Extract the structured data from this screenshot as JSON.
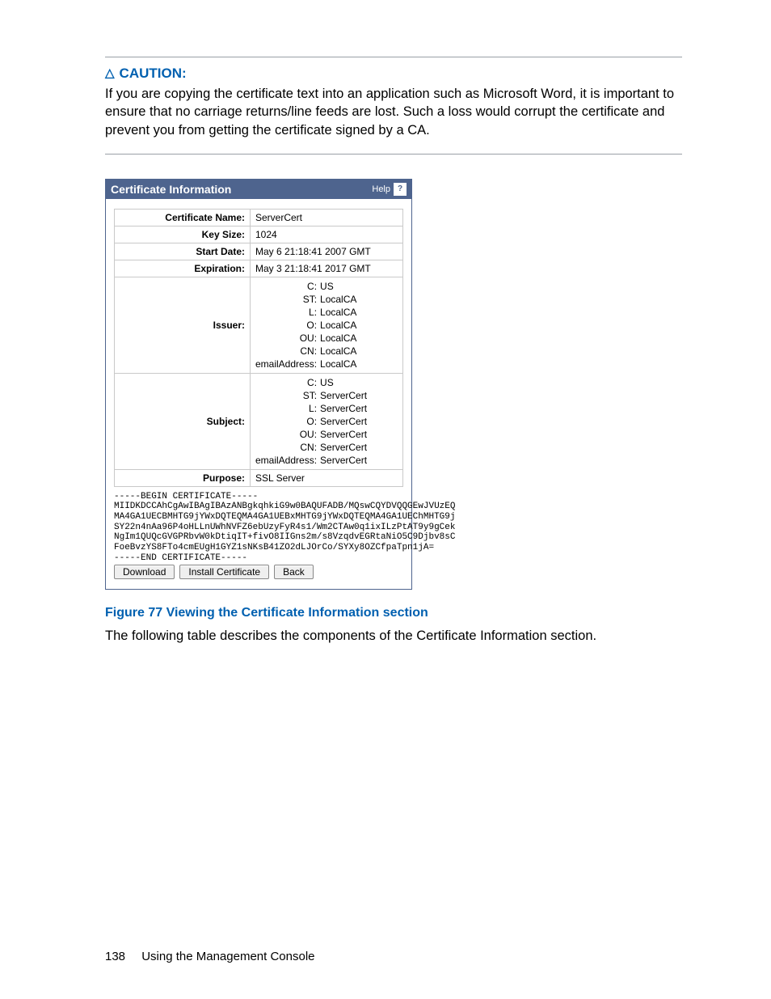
{
  "caution": {
    "label": "CAUTION:",
    "text": "If you are copying the certificate text into an application such as Microsoft Word, it is important to ensure that no carriage returns/line feeds are lost. Such a loss would corrupt the certificate and prevent you from getting the certificate signed by a CA."
  },
  "panel": {
    "title": "Certificate Information",
    "help_label": "Help",
    "rows": {
      "cert_name_label": "Certificate Name:",
      "cert_name_value": "ServerCert",
      "key_size_label": "Key Size:",
      "key_size_value": "1024",
      "start_date_label": "Start Date:",
      "start_date_value": "May  6 21:18:41 2007 GMT",
      "expiration_label": "Expiration:",
      "expiration_value": "May  3 21:18:41 2017 GMT",
      "issuer_label": "Issuer:",
      "subject_label": "Subject:",
      "purpose_label": "Purpose:",
      "purpose_value": "SSL Server"
    },
    "dn_keys": {
      "c": "C:",
      "st": "ST:",
      "l": "L:",
      "o": "O:",
      "ou": "OU:",
      "cn": "CN:",
      "email": "emailAddress:"
    },
    "issuer": {
      "c": "US",
      "st": "LocalCA",
      "l": "LocalCA",
      "o": "LocalCA",
      "ou": "LocalCA",
      "cn": "LocalCA",
      "email": "LocalCA"
    },
    "subject": {
      "c": "US",
      "st": "ServerCert",
      "l": "ServerCert",
      "o": "ServerCert",
      "ou": "ServerCert",
      "cn": "ServerCert",
      "email": "ServerCert"
    },
    "pem": "-----BEGIN CERTIFICATE-----\nMIIDKDCCAhCgAwIBAgIBAzANBgkqhkiG9w0BAQUFADB/MQswCQYDVQQGEwJVUzEQ\nMA4GA1UECBMHTG9jYWxDQTEQMA4GA1UEBxMHTG9jYWxDQTEQMA4GA1UEChMHTG9j\nSY22n4nAa96P4oHLLnUWhNVFZ6ebUzyFyR4s1/Wm2CTAw0q1ixILzPtAT9y9gCek\nNgIm1QUQcGVGPRbvW0kDtiqIT+fivO8IIGns2m/s8VzqdvEGRtaNiO5C9Djbv8sC\nFoeBvzYS8FTo4cmEUgH1GYZ1sNKsB41ZO2dLJOrCo/SYXy8OZCfpaTpn1jA=\n-----END CERTIFICATE-----",
    "buttons": {
      "download": "Download",
      "install": "Install Certificate",
      "back": "Back"
    }
  },
  "figure_caption": "Figure 77 Viewing the Certificate Information section",
  "following_text": "The following table describes the components of the Certificate Information section.",
  "footer": {
    "page": "138",
    "section": "Using the Management Console"
  }
}
